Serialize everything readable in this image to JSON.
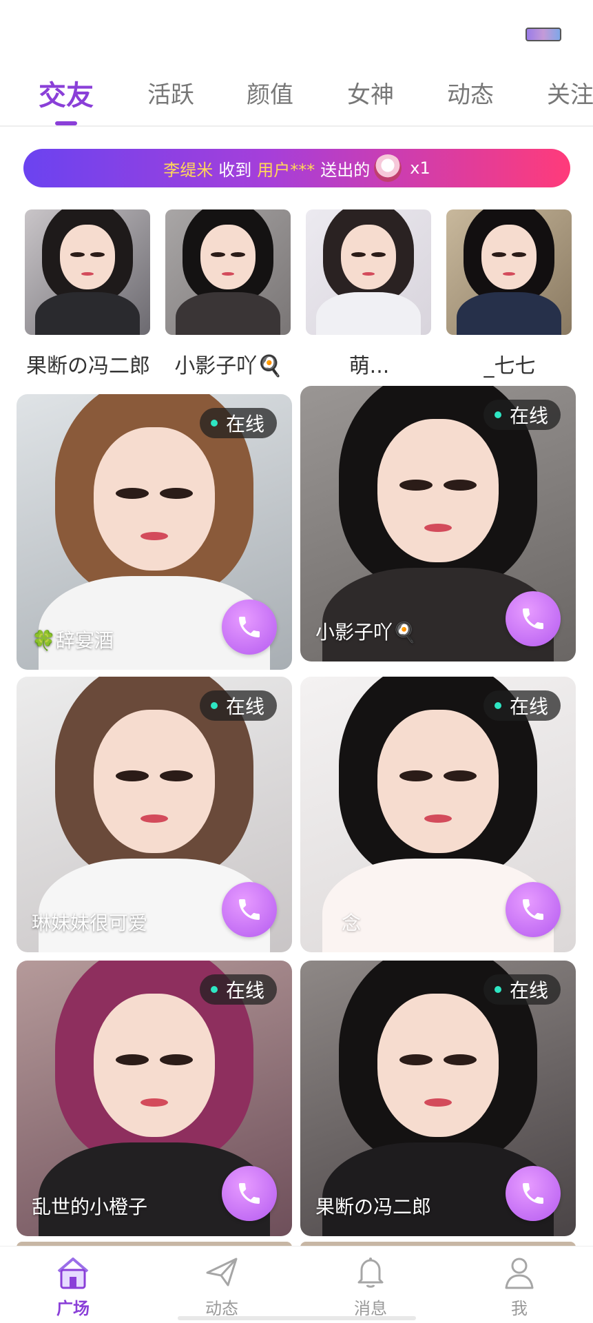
{
  "tabs": [
    {
      "label": "交友",
      "active": true
    },
    {
      "label": "活跃"
    },
    {
      "label": "颜值"
    },
    {
      "label": "女神"
    },
    {
      "label": "动态"
    },
    {
      "label": "关注"
    }
  ],
  "banner": {
    "receiver": "李缇米",
    "received_text": "收到",
    "sender": "用户***",
    "sent_text": "送出的",
    "gift_icon": "perfume-gift-icon",
    "count": "x1"
  },
  "recommended": [
    {
      "name": "果断の冯二郎"
    },
    {
      "name": "小影子吖🍳"
    },
    {
      "name": "萌..."
    },
    {
      "name": "_七七"
    }
  ],
  "cards": [
    {
      "name": "🍀辞宴酒",
      "status": "在线"
    },
    {
      "name": "小影子吖🍳",
      "status": "在线"
    },
    {
      "name": "琳妹妹很可爱",
      "status": "在线"
    },
    {
      "name": "念",
      "status": "在线"
    },
    {
      "name": "乱世的小橙子",
      "status": "在线"
    },
    {
      "name": "果断の冯二郎",
      "status": "在线"
    }
  ],
  "bottom_nav": [
    {
      "label": "广场",
      "icon": "home-icon",
      "active": true
    },
    {
      "label": "动态",
      "icon": "paper-plane-icon"
    },
    {
      "label": "消息",
      "icon": "bell-icon"
    },
    {
      "label": "我",
      "icon": "person-icon"
    }
  ],
  "colors": {
    "accent": "#8a3fd8",
    "banner_start": "#6b43f0",
    "banner_end": "#ff3b7a",
    "highlight": "#ffd659",
    "call_button": "#c46cf5",
    "online_dot": "#2ee6c3"
  }
}
